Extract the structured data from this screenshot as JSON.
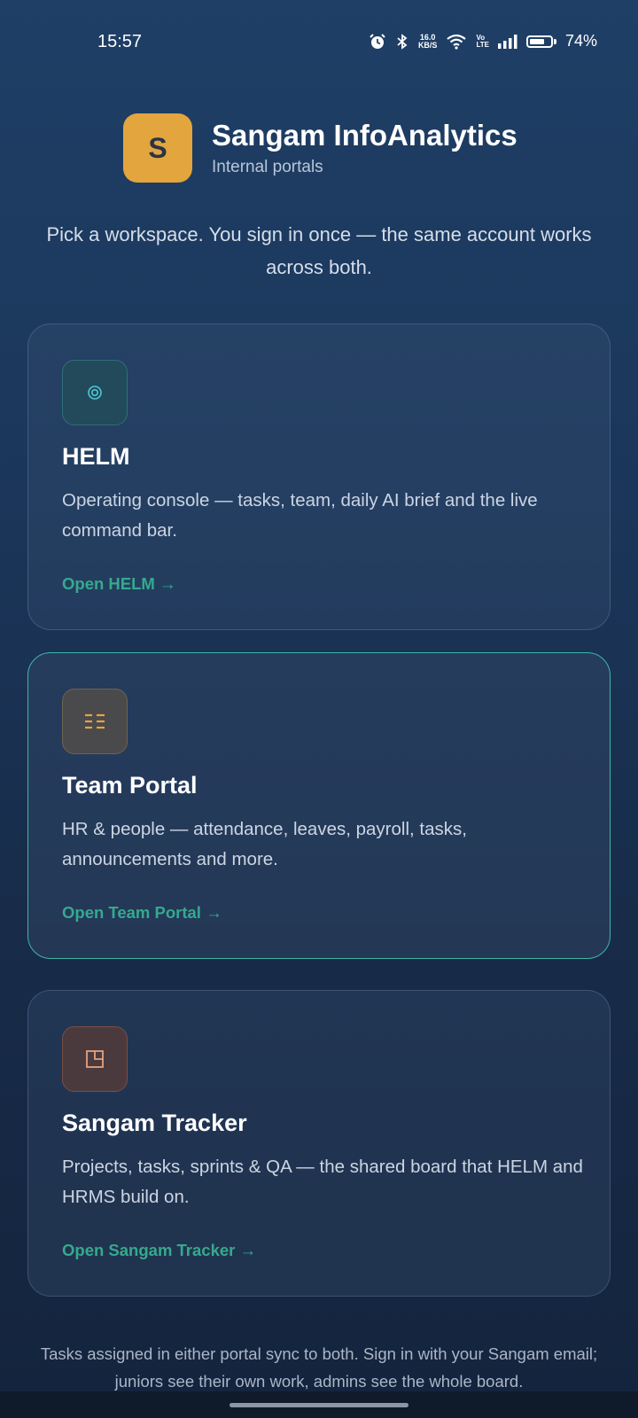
{
  "status_bar": {
    "time": "15:57",
    "net_speed_value": "16.0",
    "net_speed_unit": "KB/S",
    "volte_top": "Vo",
    "volte_bottom": "LTE",
    "battery_percent_label": "74%",
    "battery_level": 0.74
  },
  "brand": {
    "logo_letter": "S",
    "logo_color": "#e3a53d",
    "title": "Sangam InfoAnalytics",
    "subtitle": "Internal portals"
  },
  "intro": "Pick a workspace. You sign in once — the same account works across both.",
  "cards": [
    {
      "icon": "target-icon",
      "icon_glyph": "◎",
      "title": "HELM",
      "description": "Operating console — tasks, team, daily AI brief and the live command bar.",
      "link": "Open HELM →"
    },
    {
      "icon": "list-icon",
      "icon_glyph": "☷",
      "title": "Team Portal",
      "description": "HR & people — attendance, leaves, payroll, tasks, announcements and more.",
      "link": "Open Team Portal →"
    },
    {
      "icon": "board-icon",
      "icon_glyph": "◳",
      "title": "Sangam Tracker",
      "description": "Projects, tasks, sprints & QA — the shared board that HELM and HRMS build on.",
      "link": "Open Sangam Tracker →"
    }
  ],
  "colors": {
    "accent_link": "#36a98e",
    "active_border": "#3fb6a4"
  },
  "footer_note": "Tasks assigned in either portal sync to both. Sign in with your Sangam email; juniors see their own work, admins see the whole board."
}
